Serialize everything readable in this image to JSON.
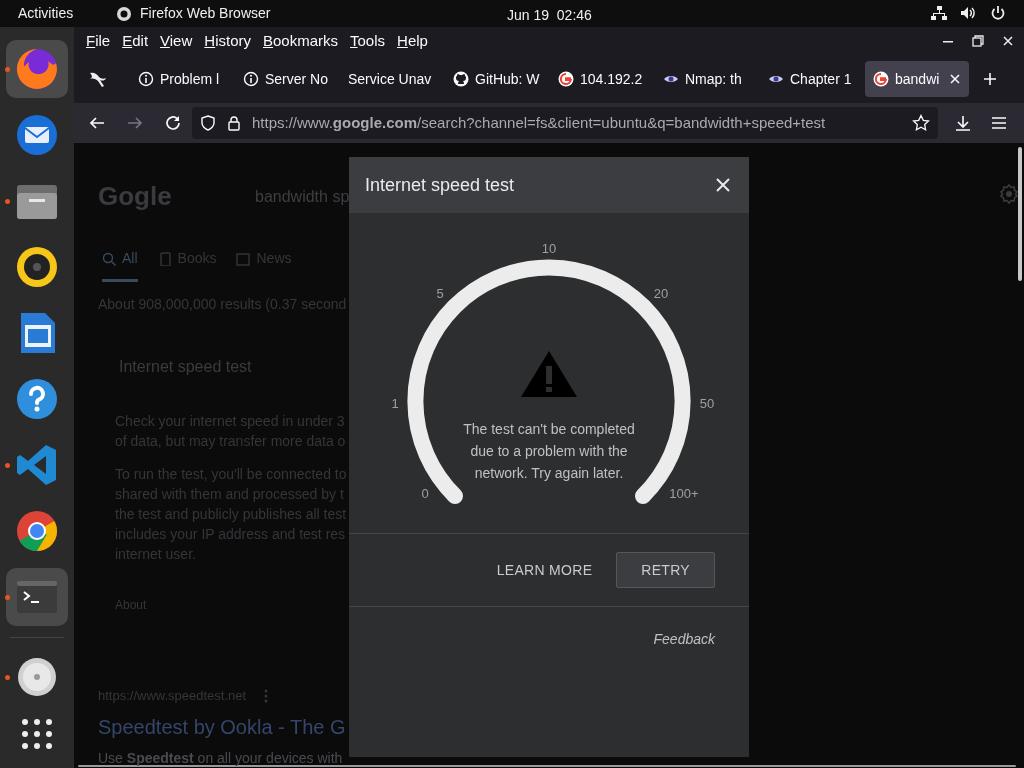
{
  "top_bar": {
    "activities": "Activities",
    "app_name": "Firefox Web Browser",
    "clock": "Jun 19  02:46"
  },
  "dock": {
    "apps": [
      {
        "kind": "firefox",
        "running": true,
        "selected": true
      },
      {
        "kind": "thunderbird",
        "running": false,
        "selected": false
      },
      {
        "kind": "files",
        "running": true,
        "selected": false
      },
      {
        "kind": "rhythmbox",
        "running": false,
        "selected": false
      },
      {
        "kind": "writer",
        "running": false,
        "selected": false
      },
      {
        "kind": "help",
        "running": false,
        "selected": false
      },
      {
        "kind": "vscode",
        "running": true,
        "selected": false
      },
      {
        "kind": "chrome",
        "running": false,
        "selected": false
      },
      {
        "kind": "terminal",
        "running": true,
        "selected": true
      },
      {
        "kind": "disk",
        "running": true,
        "selected": false
      }
    ]
  },
  "menu_bar": [
    "File",
    "Edit",
    "View",
    "History",
    "Bookmarks",
    "Tools",
    "Help"
  ],
  "tabs": [
    {
      "title": "Problem l",
      "kind": "info",
      "selected": false
    },
    {
      "title": "Server No",
      "kind": "info",
      "selected": false
    },
    {
      "title": "Service Unav",
      "kind": "plain",
      "selected": false
    },
    {
      "title": "GitHub: W",
      "kind": "github",
      "selected": false
    },
    {
      "title": "104.192.2",
      "kind": "google",
      "selected": false
    },
    {
      "title": "Nmap: th",
      "kind": "eye",
      "selected": false
    },
    {
      "title": "Chapter 1",
      "kind": "eye",
      "selected": false
    },
    {
      "title": "bandwi",
      "kind": "google",
      "selected": true
    }
  ],
  "address": "https://www.**google.com**/search?channel=fs&client=ubuntu&q=bandwidth+speed+test",
  "page": {
    "logo": "Gogle",
    "query": "bandwidth sp",
    "filters": [
      {
        "label": "All",
        "kind": "search",
        "selected": true
      },
      {
        "label": "Books",
        "kind": "book",
        "selected": false
      },
      {
        "label": "News",
        "kind": "news",
        "selected": false
      }
    ],
    "result_stats": "About 908,000,000 results (0.37 second",
    "card_title": "Internet speed test",
    "paragraphs": [
      "Check your internet speed in under 3\nof data, but may transfer more data o",
      "To run the test, you'll be connected to\nshared with them and processed by t\nthe test and publicly publishes all test\nincludes your IP address and test res\ninternet user."
    ],
    "about": "About",
    "result": {
      "url": "https://www.speedtest.net",
      "title": "Speedtest by Ookla - The G",
      "snippet": "Use **Speedtest** on all your devices with"
    }
  },
  "dialog": {
    "title": "Internet speed test",
    "gauge_labels": [
      "0",
      "1",
      "5",
      "10",
      "20",
      "50",
      "100+"
    ],
    "message": "The test can't be completed due to a problem with the network. Try again later.",
    "buttons": [
      {
        "label": "LEARN MORE",
        "kind": "text"
      },
      {
        "label": "RETRY",
        "kind": "outlined"
      }
    ],
    "feedback": "Feedback"
  }
}
